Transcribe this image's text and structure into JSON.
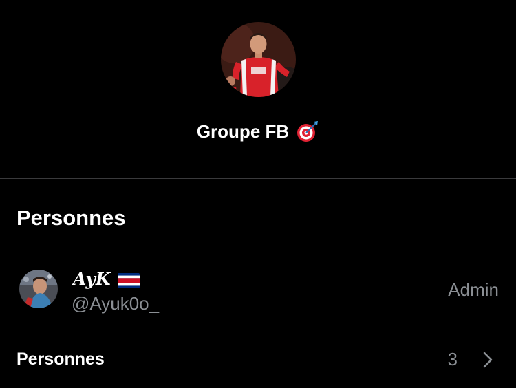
{
  "group": {
    "title": "Groupe FB",
    "title_emoji": "target-emoji"
  },
  "people_section": {
    "heading": "Personnes",
    "members": [
      {
        "name": "AyK",
        "flag": "costa-rica-flag",
        "handle": "@Ayuk0o_",
        "role": "Admin"
      }
    ]
  },
  "people_row": {
    "label": "Personnes",
    "count": "3"
  },
  "colors": {
    "background": "#000000",
    "text_primary": "#ffffff",
    "text_secondary": "#8b8f94",
    "divider": "#3a3a3c",
    "jersey_red": "#d8222a"
  }
}
